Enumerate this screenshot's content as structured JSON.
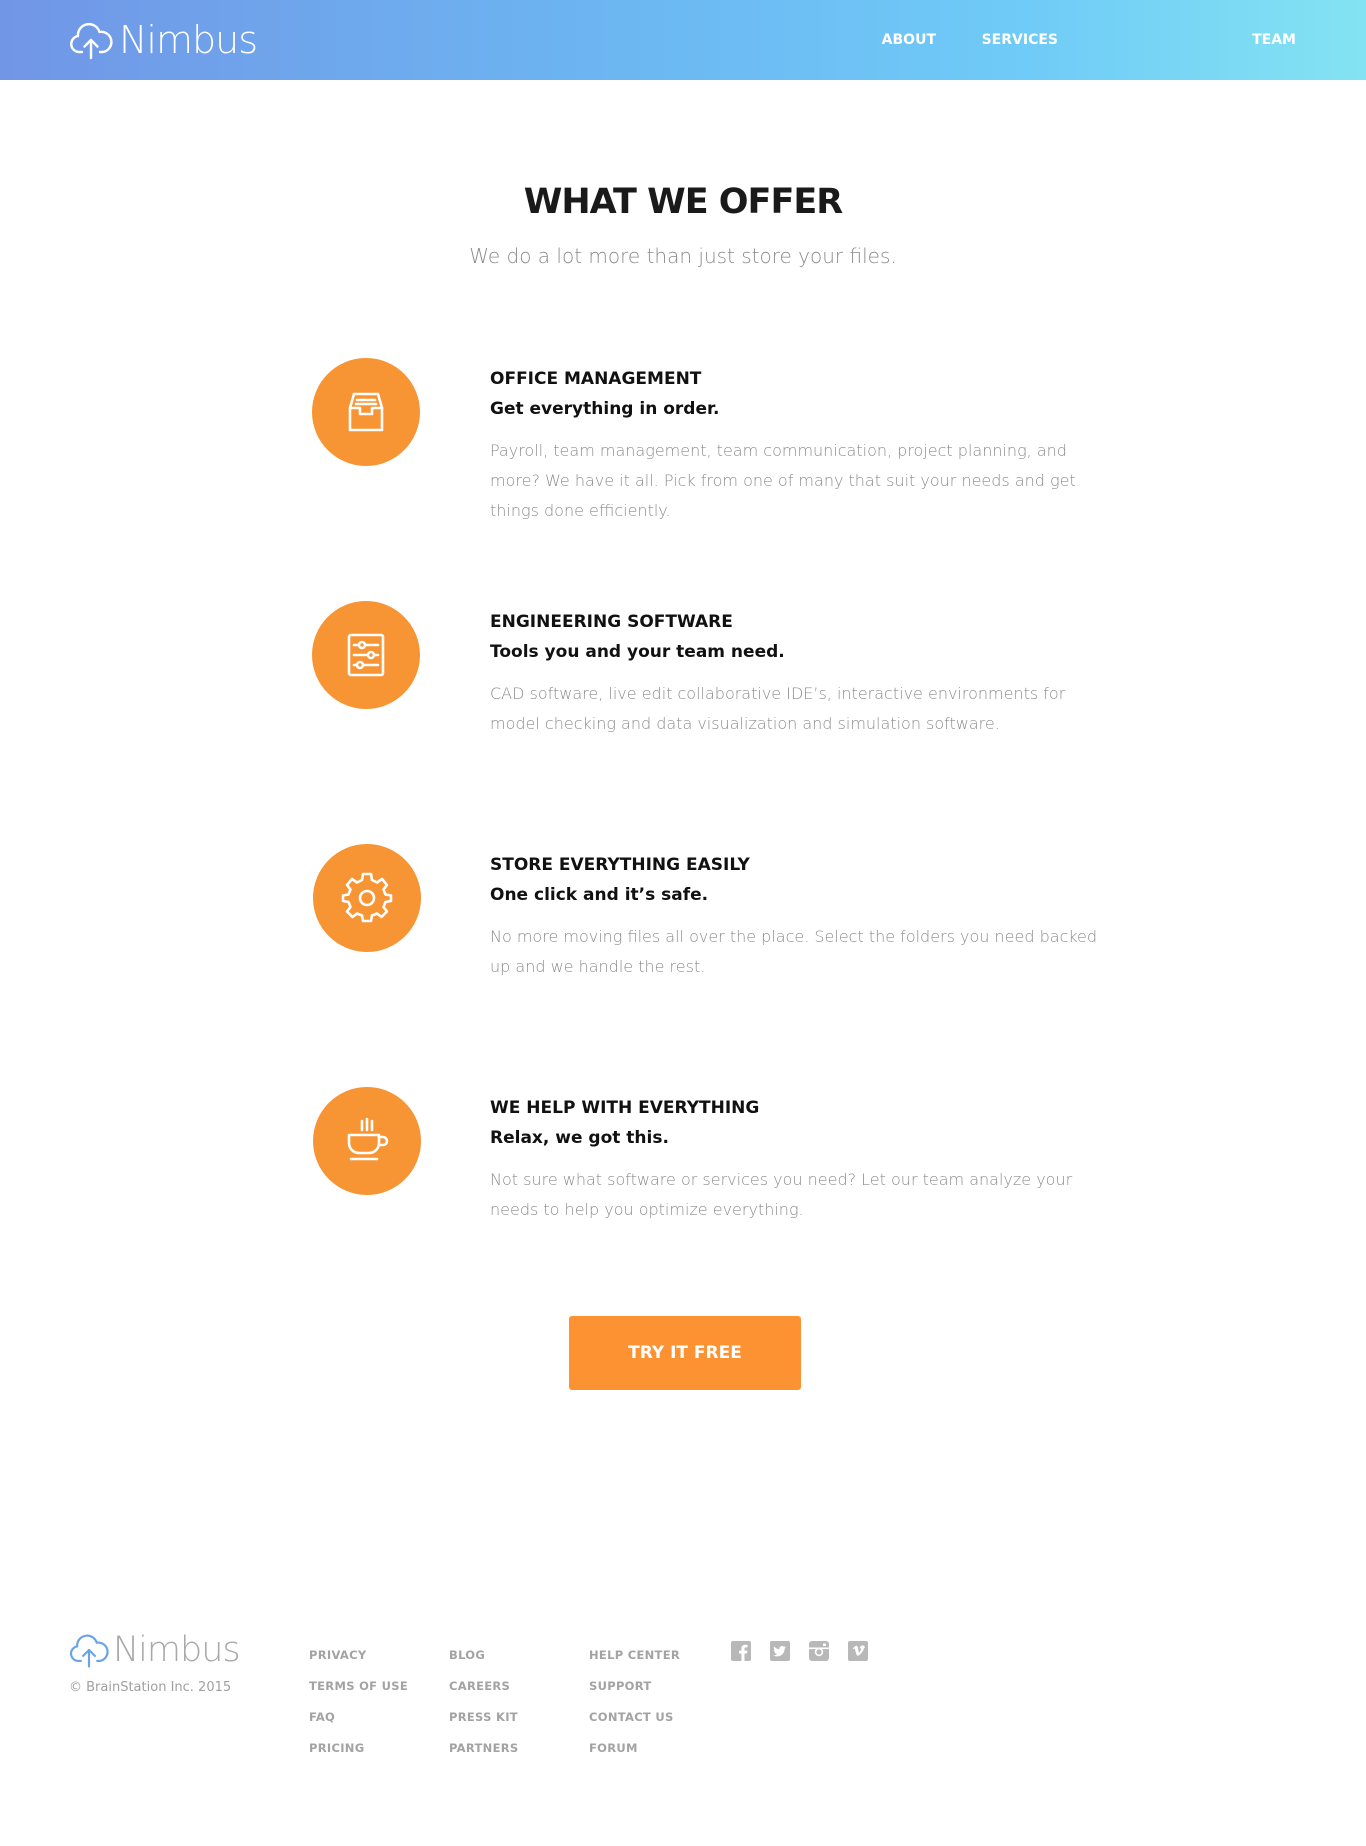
{
  "header": {
    "logo_text": "Nimbus",
    "nav": [
      {
        "label": "ABOUT"
      },
      {
        "label": "SERVICES"
      },
      {
        "label": "TEAM"
      }
    ]
  },
  "main": {
    "title": "WHAT WE OFFER",
    "subtitle": "We do a lot more than just store your files.",
    "features": [
      {
        "icon": "inbox-tray-icon",
        "title": "OFFICE MANAGEMENT",
        "tagline": "Get everything in order.",
        "description": "Payroll, team management, team communication, project planning, and more? We have it all. Pick from one of many that suit your needs and get things done efficiently."
      },
      {
        "icon": "sliders-icon",
        "title": "ENGINEERING SOFTWARE",
        "tagline": "Tools you and your team need.",
        "description": "CAD software, live edit collaborative IDE’s, interactive environments for model checking and data visualization and simulation software."
      },
      {
        "icon": "gear-icon",
        "title": "STORE EVERYTHING EASILY",
        "tagline": "One click and it’s safe.",
        "description": "No more moving files all over the place. Select the folders you need backed up  and we handle the rest."
      },
      {
        "icon": "coffee-cup-icon",
        "title": "WE HELP WITH EVERYTHING",
        "tagline": "Relax, we got this.",
        "description": "Not sure what software or services you need? Let our team analyze your needs to help you optimize everything."
      }
    ],
    "cta_label": "TRY IT FREE"
  },
  "footer": {
    "logo_text": "Nimbus",
    "copyright": "© BrainStation Inc. 2015",
    "columns": [
      [
        "PRIVACY",
        "TERMS OF USE",
        "FAQ",
        "PRICING"
      ],
      [
        "BLOG",
        "CAREERS",
        "PRESS KIT",
        "PARTNERS"
      ],
      [
        "HELP CENTER",
        "SUPPORT",
        "CONTACT US",
        "FORUM"
      ]
    ],
    "social": [
      "facebook-icon",
      "twitter-icon",
      "instagram-icon",
      "vimeo-icon"
    ]
  },
  "colors": {
    "accent": "#f79433",
    "cta": "#fc9232",
    "header_gradient_start": "#7196e6",
    "header_gradient_end": "#84e3f2"
  }
}
